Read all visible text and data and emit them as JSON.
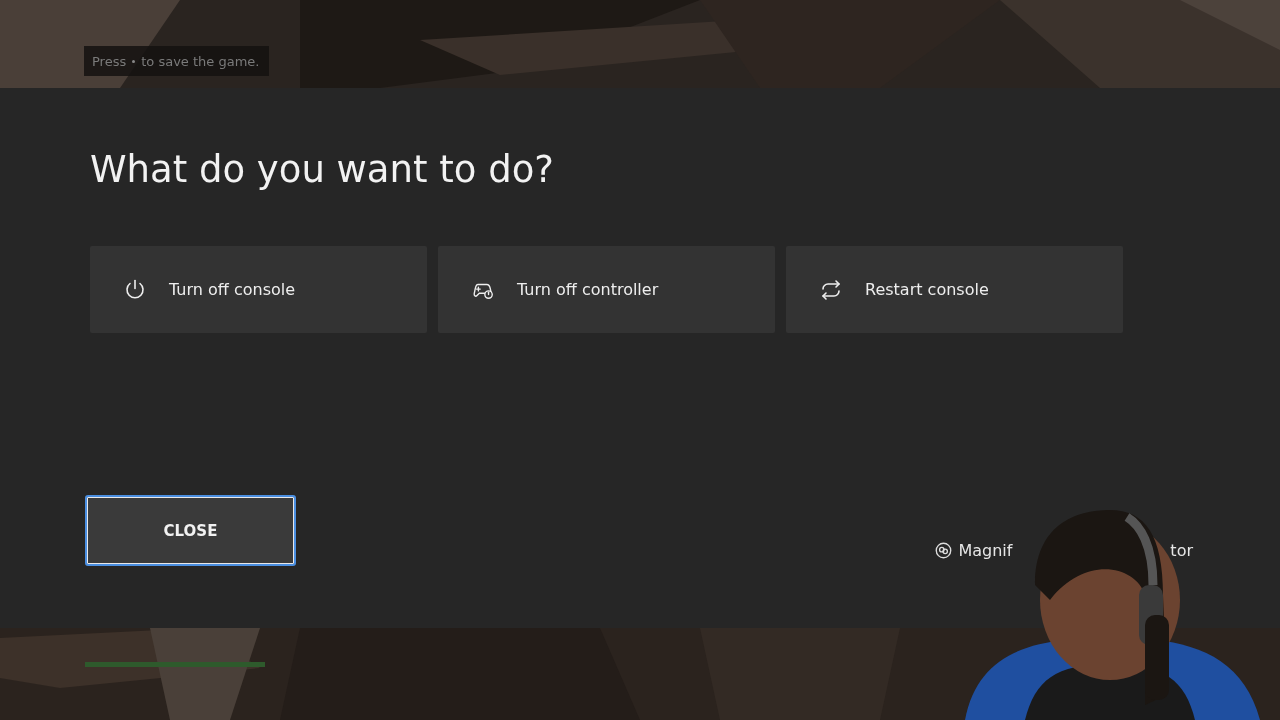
{
  "game_hint": {
    "before": "Press",
    "after": "to save the game."
  },
  "dialog": {
    "title": "What do you want to do?",
    "options": [
      {
        "kind": "power",
        "label": "Turn off console"
      },
      {
        "kind": "controller",
        "label": "Turn off controller"
      },
      {
        "kind": "restart",
        "label": "Restart console"
      }
    ],
    "close_button": {
      "label": "CLOSE",
      "focused": true
    },
    "magnifier": {
      "visible_start": "Magnif",
      "visible_end": "tor"
    }
  }
}
